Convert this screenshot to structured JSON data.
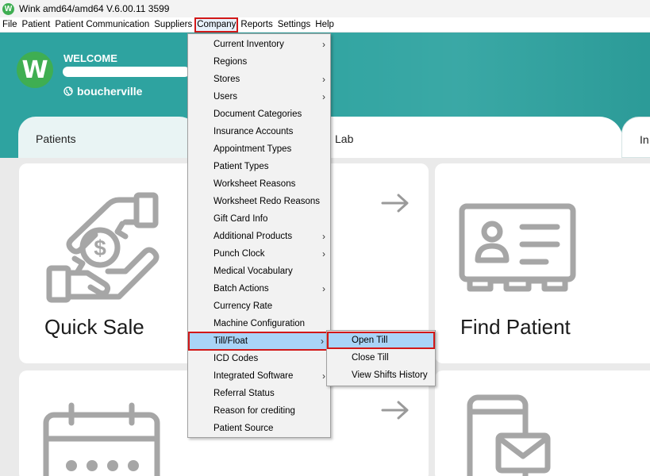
{
  "window": {
    "title": "Wink amd64/amd64 V.6.00.11 3599",
    "icon_letter": "W"
  },
  "menubar": {
    "items": [
      "File",
      "Patient",
      "Patient Communication",
      "Suppliers",
      "Company",
      "Reports",
      "Settings",
      "Help"
    ]
  },
  "header": {
    "logo_letter": "W",
    "welcome": "WELCOME",
    "location": "boucherville"
  },
  "tabs": [
    "Patients",
    "Lab",
    "In"
  ],
  "cards": {
    "quick_sale": "Quick Sale",
    "find_patient": "Find Patient"
  },
  "company_menu": {
    "items": [
      {
        "label": "Current Inventory",
        "submenu": true
      },
      {
        "label": "Regions",
        "submenu": false
      },
      {
        "label": "Stores",
        "submenu": true
      },
      {
        "label": "Users",
        "submenu": true
      },
      {
        "label": "Document Categories",
        "submenu": false
      },
      {
        "label": "Insurance Accounts",
        "submenu": false
      },
      {
        "label": "Appointment Types",
        "submenu": false
      },
      {
        "label": "Patient Types",
        "submenu": false
      },
      {
        "label": "Worksheet Reasons",
        "submenu": false
      },
      {
        "label": "Worksheet Redo Reasons",
        "submenu": false
      },
      {
        "label": "Gift Card Info",
        "submenu": false
      },
      {
        "label": "Additional Products",
        "submenu": true
      },
      {
        "label": "Punch Clock",
        "submenu": true
      },
      {
        "label": "Medical Vocabulary",
        "submenu": false
      },
      {
        "label": "Batch Actions",
        "submenu": true
      },
      {
        "label": "Currency Rate",
        "submenu": false
      },
      {
        "label": "Machine Configuration",
        "submenu": false
      },
      {
        "label": "Till/Float",
        "submenu": true
      },
      {
        "label": "ICD Codes",
        "submenu": false
      },
      {
        "label": "Integrated Software",
        "submenu": true
      },
      {
        "label": "Referral Status",
        "submenu": false
      },
      {
        "label": "Reason for crediting",
        "submenu": false
      },
      {
        "label": "Patient Source",
        "submenu": false
      }
    ]
  },
  "till_submenu": {
    "items": [
      "Open Till",
      "Close Till",
      "View Shifts History"
    ]
  },
  "colors": {
    "teal": "#2ea3a0",
    "brand_green": "#3fae52",
    "highlight": "#a9d4f7",
    "annotation_red": "#d21818"
  }
}
